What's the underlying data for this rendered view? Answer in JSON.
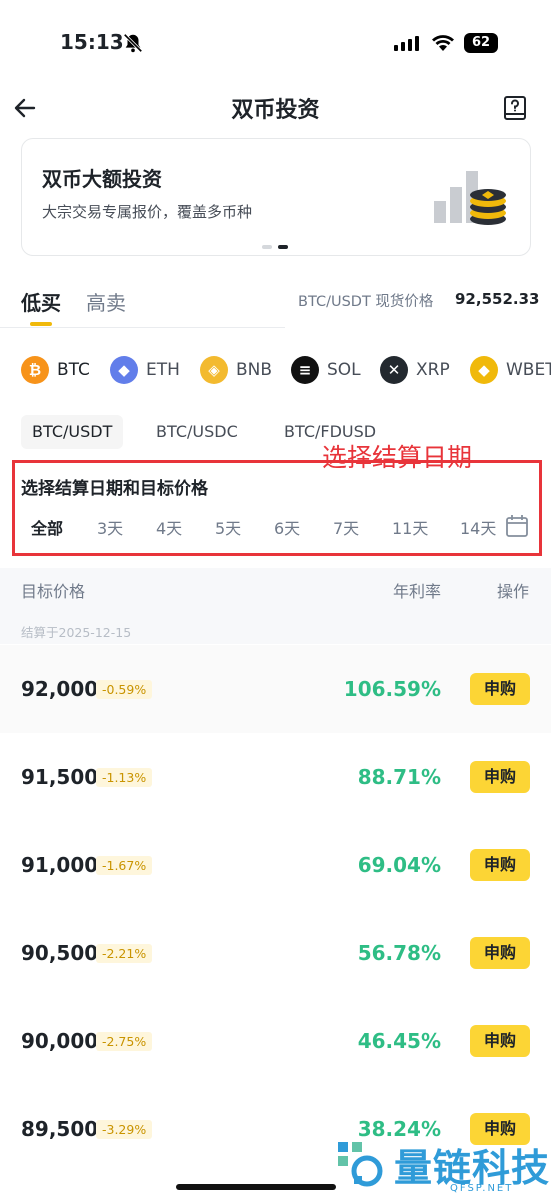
{
  "status_bar": {
    "time": "15:13",
    "battery": "62"
  },
  "header": {
    "title": "双币投资"
  },
  "banner": {
    "title": "双币大额投资",
    "subtitle": "大宗交易专属报价，覆盖多币种"
  },
  "tabs": {
    "buy": "低买",
    "sell": "高卖"
  },
  "spot": {
    "label": "BTC/USDT 现货价格",
    "price": "92,552.33"
  },
  "coins": [
    {
      "name": "BTC",
      "color": "#f7931a",
      "glyph": "₿"
    },
    {
      "name": "ETH",
      "color": "#627eea",
      "glyph": "◆"
    },
    {
      "name": "BNB",
      "color": "#f3ba2f",
      "glyph": "◈"
    },
    {
      "name": "SOL",
      "color": "#111111",
      "glyph": "≡"
    },
    {
      "name": "XRP",
      "color": "#23292f",
      "glyph": "✕"
    },
    {
      "name": "WBET",
      "color": "#f0b90b",
      "glyph": "◆"
    }
  ],
  "pairs": [
    "BTC/USDT",
    "BTC/USDC",
    "BTC/FDUSD"
  ],
  "annotation": {
    "text": "选择结算日期"
  },
  "section_label": "选择结算日期和目标价格",
  "days": [
    "全部",
    "3天",
    "4天",
    "5天",
    "6天",
    "7天",
    "11天",
    "14天"
  ],
  "table": {
    "col_target": "目标价格",
    "col_apr": "年利率",
    "col_action": "操作",
    "settle_note": "结算于2025-12-15"
  },
  "rows": [
    {
      "price": "92,000",
      "change": "-0.59%",
      "apr": "106.59%",
      "action": "申购"
    },
    {
      "price": "91,500",
      "change": "-1.13%",
      "apr": "88.71%",
      "action": "申购"
    },
    {
      "price": "91,000",
      "change": "-1.67%",
      "apr": "69.04%",
      "action": "申购"
    },
    {
      "price": "90,500",
      "change": "-2.21%",
      "apr": "56.78%",
      "action": "申购"
    },
    {
      "price": "90,000",
      "change": "-2.75%",
      "apr": "46.45%",
      "action": "申购"
    },
    {
      "price": "89,500",
      "change": "-3.29%",
      "apr": "38.24%",
      "action": "申购"
    }
  ],
  "watermark": {
    "text": "量链科技",
    "sub": "QFSP.NET"
  }
}
